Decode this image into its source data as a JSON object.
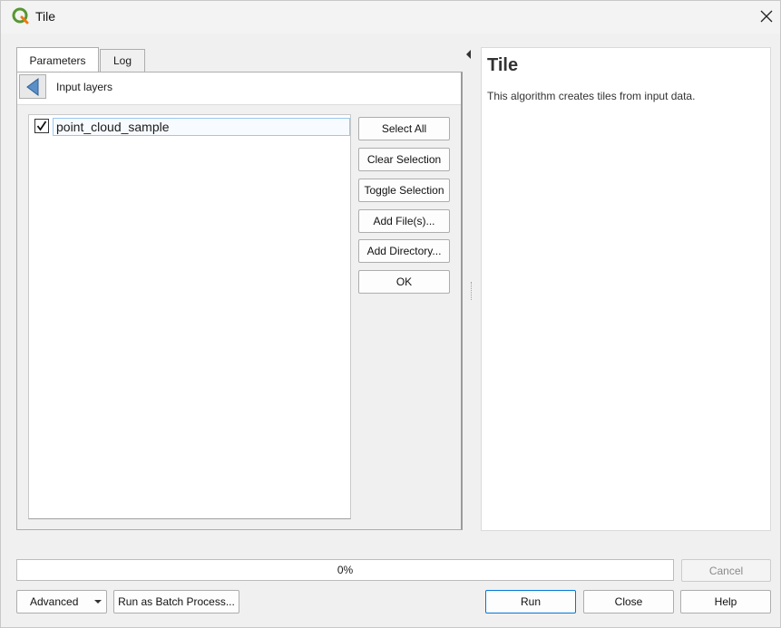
{
  "window": {
    "title": "Tile",
    "icon": "qgis-icon"
  },
  "tabs": [
    {
      "label": "Parameters",
      "active": true
    },
    {
      "label": "Log",
      "active": false
    }
  ],
  "parameter_panel": {
    "header_label": "Input layers",
    "items": [
      {
        "label": "point_cloud_sample",
        "checked": true
      }
    ],
    "buttons": {
      "select_all": "Select All",
      "clear_selection": "Clear Selection",
      "toggle_selection": "Toggle Selection",
      "add_files": "Add File(s)...",
      "add_directory": "Add Directory...",
      "ok": "OK"
    }
  },
  "help": {
    "title": "Tile",
    "description": "This algorithm creates tiles from input data."
  },
  "progress": {
    "value": 0,
    "label": "0%"
  },
  "footer": {
    "cancel": "Cancel",
    "advanced": "Advanced",
    "batch": "Run as Batch Process...",
    "run": "Run",
    "close": "Close",
    "help": "Help"
  },
  "colors": {
    "accent": "#0078d7",
    "progress": "#06b025",
    "qgis_green": "#589632"
  }
}
